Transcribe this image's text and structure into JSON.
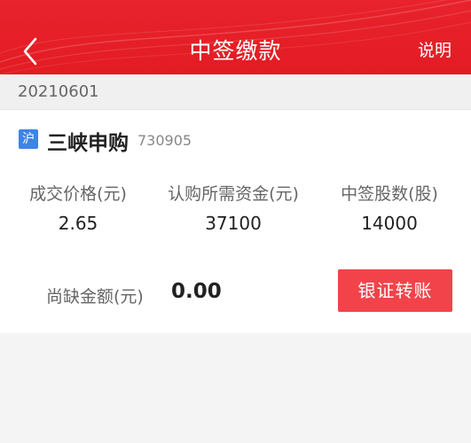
{
  "header": {
    "title": "中签缴款",
    "back_icon": "chevron-left-icon",
    "help_label": "说明",
    "color": "#e31b23"
  },
  "date": "20210601",
  "stock": {
    "market": "沪",
    "name": "三峡申购",
    "code": "730905"
  },
  "metrics": [
    {
      "label": "成交价格(元)",
      "value": "2.65"
    },
    {
      "label": "认购所需资金(元)",
      "value": "37100"
    },
    {
      "label": "中签股数(股)",
      "value": "14000"
    }
  ],
  "shortfall": {
    "label": "尚缺金额(元)",
    "value": "0.00"
  },
  "transfer_button": {
    "label": "银证转账",
    "color": "#f2434a"
  }
}
